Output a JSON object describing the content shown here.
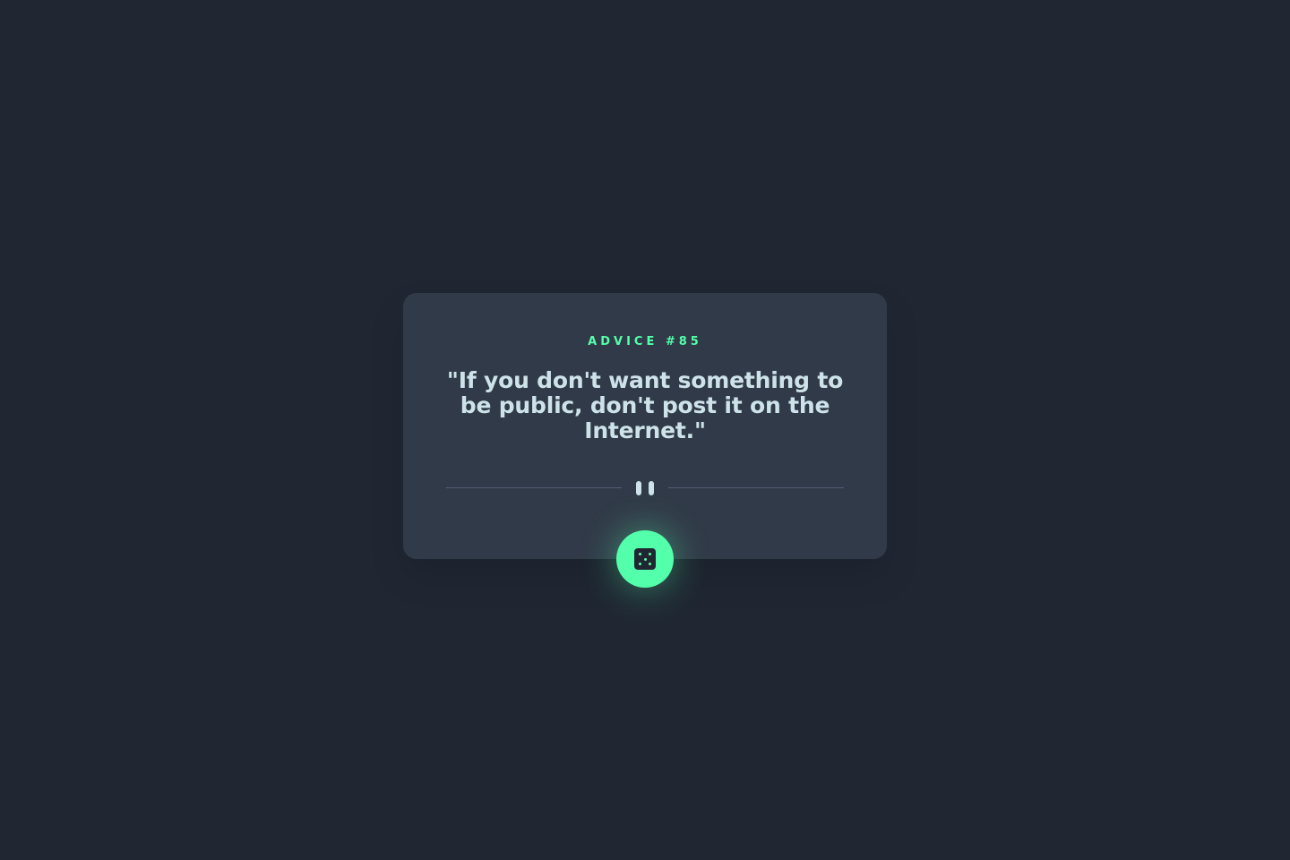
{
  "card": {
    "advice_id_label": "ADVICE #85",
    "advice_text": "\"If you don't want something to be public, don't post it on the Internet.\""
  },
  "divider": {
    "icon": "pause-icon"
  },
  "button": {
    "icon": "dice-icon",
    "aria_label": "Generate new advice"
  },
  "colors": {
    "background": "#202733",
    "card": "#313A48",
    "accent": "#53FFAA",
    "text": "#CEE3E9",
    "divider": "#4F5D74"
  }
}
